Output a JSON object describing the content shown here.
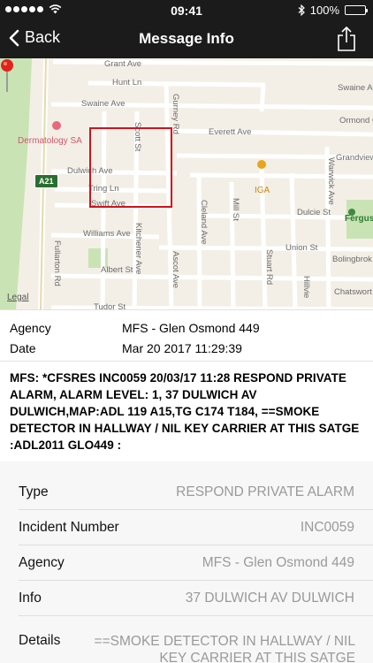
{
  "status_bar": {
    "time": "09:41",
    "battery_text": "100%"
  },
  "nav": {
    "back_label": "Back",
    "title": "Message Info"
  },
  "map": {
    "labels": {
      "grant_ave": "Grant Ave",
      "hunt_ln": "Hunt Ln",
      "swaine_ave_w": "Swaine Ave",
      "swaine_ave_e": "Swaine Ave",
      "scott_st": "Scott St",
      "gurney_rd": "Gurney Rd",
      "everett_ave": "Everett Ave",
      "ormond_gr": "Ormond Gr",
      "grandview": "Grandview",
      "dulwich_ave": "Dulwich Ave",
      "tring_ln": "Tring Ln",
      "swift_ave": "Swift Ave",
      "williams_ave": "Williams Ave",
      "kitchener_ave": "Kitchener Ave",
      "cleland_ave": "Cleland Ave",
      "mill_st": "Mill St",
      "dulcie_st": "Dulcie St",
      "warwick_ave": "Warwick Ave",
      "union_st": "Union St",
      "stuart_rd": "Stuart Rd",
      "bolingbroke": "Bolingbrok",
      "albert_st": "Albert St",
      "ascot_ave": "Ascot Ave",
      "fullarton_rd": "Fullarton Rd",
      "tudor_st": "Tudor St",
      "chatsworth": "Chatswort",
      "hillview": "Hillvie"
    },
    "poi_dermatology": "Dermatology SA",
    "poi_iga": "IGA",
    "poi_ferguson": "Ferguss",
    "road_badge": "A21",
    "legal": "Legal",
    "colors": {
      "park": "#c9e3b5",
      "road": "#ffffff",
      "background": "#f3efe6",
      "highlight": "#d0131c"
    }
  },
  "info": {
    "agency_label": "Agency",
    "agency_value": "MFS - Glen Osmond 449",
    "date_label": "Date",
    "date_value": "Mar 20 2017 11:29:39"
  },
  "message_text": "MFS: *CFSRES INC0059 20/03/17 11:28 RESPOND PRIVATE ALARM, ALARM LEVEL: 1, 37 DULWICH AV DULWICH,MAP:ADL 119 A15,TG C174 T184, ==SMOKE DETECTOR IN HALLWAY / NIL KEY CARRIER AT THIS SATGE :ADL2011 GLO449 :",
  "details": [
    {
      "label": "Type",
      "value": "RESPOND PRIVATE ALARM"
    },
    {
      "label": "Incident Number",
      "value": "INC0059"
    },
    {
      "label": "Agency",
      "value": "MFS - Glen Osmond 449"
    },
    {
      "label": "Info",
      "value": "37 DULWICH AV DULWICH"
    }
  ],
  "details_row": {
    "label": "Details",
    "value": "==SMOKE DETECTOR IN HALLWAY / NIL KEY CARRIER AT THIS SATGE"
  }
}
